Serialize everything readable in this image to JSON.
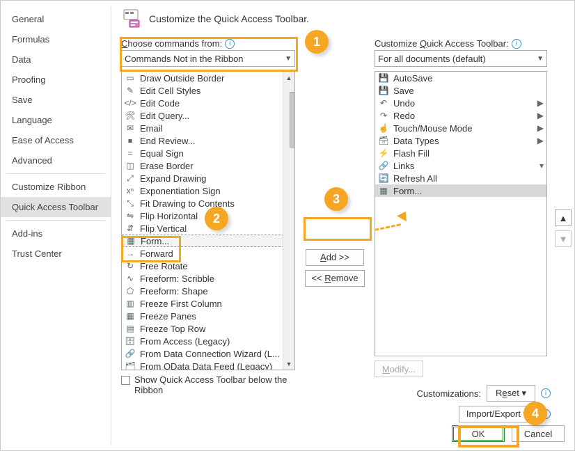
{
  "sidebar": {
    "items": [
      {
        "label": "General"
      },
      {
        "label": "Formulas"
      },
      {
        "label": "Data"
      },
      {
        "label": "Proofing"
      },
      {
        "label": "Save"
      },
      {
        "label": "Language"
      },
      {
        "label": "Ease of Access"
      },
      {
        "label": "Advanced"
      },
      {
        "label": "Customize Ribbon"
      },
      {
        "label": "Quick Access Toolbar"
      },
      {
        "label": "Add-ins"
      },
      {
        "label": "Trust Center"
      }
    ],
    "selected_index": 9
  },
  "title": "Customize the Quick Access Toolbar.",
  "left": {
    "label": "Choose commands from:",
    "select_value": "Commands Not in the Ribbon",
    "items": [
      "Draw Outside Border",
      "Edit Cell Styles",
      "Edit Code",
      "Edit Query...",
      "Email",
      "End Review...",
      "Equal Sign",
      "Erase Border",
      "Expand Drawing",
      "Exponentiation Sign",
      "Fit Drawing to Contents",
      "Flip Horizontal",
      "Flip Vertical",
      "Form...",
      "Forward",
      "Free Rotate",
      "Freeform: Scribble",
      "Freeform: Shape",
      "Freeze First Column",
      "Freeze Panes",
      "Freeze Top Row",
      "From Access (Legacy)",
      "From Data Connection Wizard (L...",
      "From OData Data Feed (Legacy)"
    ],
    "selected_index": 13,
    "checkbox_label": "Show Quick Access Toolbar below the Ribbon"
  },
  "mid": {
    "add": "Add >>",
    "remove": "<< Remove"
  },
  "right": {
    "label": "Customize Quick Access Toolbar:",
    "select_value": "For all documents (default)",
    "items": [
      {
        "label": "AutoSave",
        "sub": ""
      },
      {
        "label": "Save",
        "sub": ""
      },
      {
        "label": "Undo",
        "sub": "▶"
      },
      {
        "label": "Redo",
        "sub": "▶"
      },
      {
        "label": "Touch/Mouse Mode",
        "sub": "▶"
      },
      {
        "label": "Data Types",
        "sub": "▶"
      },
      {
        "label": "Flash Fill",
        "sub": ""
      },
      {
        "label": "Links",
        "sub": "▾"
      },
      {
        "label": "Refresh All",
        "sub": ""
      },
      {
        "label": "Form...",
        "sub": ""
      }
    ],
    "selected_index": 9,
    "modify": "Modify...",
    "custom_label": "Customizations:",
    "reset": "Reset ▾",
    "impexp": "Import/Export ▾"
  },
  "footer": {
    "ok": "OK",
    "cancel": "Cancel"
  },
  "callouts": {
    "c1": "1",
    "c2": "2",
    "c3": "3",
    "c4": "4"
  }
}
